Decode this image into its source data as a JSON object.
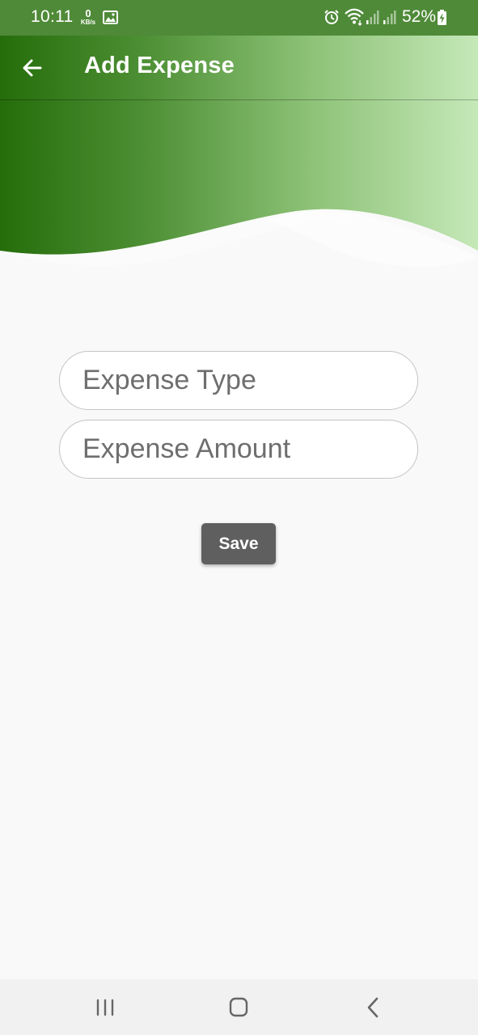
{
  "status_bar": {
    "time": "10:11",
    "network_speed_value": "0",
    "network_speed_unit": "KB/s",
    "battery_percent": "52%",
    "icons": [
      "image-icon",
      "alarm-icon",
      "wifi-icon",
      "signal-icon",
      "signal-icon",
      "battery-charging-icon"
    ]
  },
  "app_bar": {
    "title": "Add Expense",
    "back_icon": "arrow-left-icon"
  },
  "form": {
    "expense_type": {
      "placeholder": "Expense Type",
      "value": ""
    },
    "expense_amount": {
      "placeholder": "Expense Amount",
      "value": ""
    },
    "save_label": "Save"
  },
  "nav_bar": {
    "icons": [
      "recents-icon",
      "home-icon",
      "back-icon"
    ]
  },
  "colors": {
    "header_dark_green": "#2a7010",
    "header_light_green": "#c2e6b4",
    "background": "#f9f9f9",
    "save_button": "#5f5f5f",
    "field_border": "#c4c4c4"
  }
}
